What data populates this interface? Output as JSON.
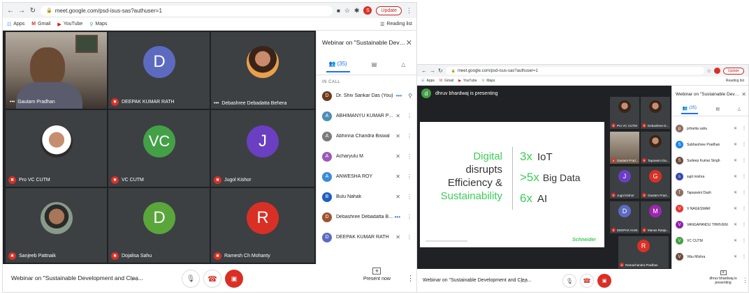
{
  "left": {
    "url": "meet.google.com/psd-isus-sas?authuser=1",
    "update_label": "Update",
    "profile_initial": "S",
    "bookmarks": [
      "Apps",
      "Gmail",
      "YouTube",
      "Maps"
    ],
    "reading_list": "Reading list",
    "tiles": [
      {
        "name": "Gautam Pradhan",
        "kind": "video"
      },
      {
        "name": "DEEPAK KUMAR RATH",
        "initial": "D",
        "color": "#5c6bc0"
      },
      {
        "name": "Debashree Debadatta Behera",
        "kind": "photo"
      },
      {
        "name": "Pro VC CUTM",
        "kind": "photo"
      },
      {
        "name": "VC CUTM",
        "initial": "VC",
        "color": "#43a047"
      },
      {
        "name": "Jugol Kishor",
        "initial": "J",
        "color": "#6a3fc1"
      },
      {
        "name": "Sanjeeb Pattnaik",
        "kind": "photo"
      },
      {
        "name": "Dojalisa Sahu",
        "initial": "D",
        "color": "#5aa63b"
      },
      {
        "name": "Ramesh Ch Mohanty",
        "initial": "R",
        "color": "#d93025"
      }
    ],
    "meeting_title": "Webinar on \"Sustainable Development and Clea...",
    "present_label": "Present now",
    "panel_title": "Webinar on \"Sustainable Develop...",
    "people_count": "(35)",
    "in_call": "IN CALL",
    "participants": [
      {
        "name": "Dr. Shiv Sankar Das (You)",
        "initial": "D",
        "color": "#6d3b1d"
      },
      {
        "name": "ABHIMANYU KUMAR PA...",
        "initial": "A",
        "color": "#4a8fb5",
        "photo": true
      },
      {
        "name": "Abhinna Chandra Biswal",
        "initial": "A",
        "color": "#7a7a7a",
        "photo": true
      },
      {
        "name": "Acharyulu M",
        "initial": "A",
        "color": "#9b59b6"
      },
      {
        "name": "ANWESHA ROY",
        "initial": "A",
        "color": "#3b8ad9"
      },
      {
        "name": "Bulu Nahak",
        "initial": "B",
        "color": "#1f5fbf"
      },
      {
        "name": "Debashree Debadatta B...",
        "initial": "D",
        "color": "#a0522d",
        "photo": true
      },
      {
        "name": "DEEPAK KUMAR RATH",
        "initial": "D",
        "color": "#5c6bc0"
      }
    ]
  },
  "right": {
    "url": "meet.google.com/psd-isus-sas?authuser=1",
    "update_label": "Update",
    "bookmarks": [
      "Apps",
      "Gmail",
      "YouTube",
      "Maps"
    ],
    "reading_list": "Reading list",
    "presenter_initial": "d",
    "presenting_banner": "dhruv bhardwaj is presenting",
    "slide": {
      "left_lines": [
        "Digital",
        "disrupts",
        "Efficiency &",
        "Sustainability"
      ],
      "stats": [
        {
          "num": "3x",
          "label": "IoT"
        },
        {
          "num": ">5x",
          "label": "Big Data"
        },
        {
          "num": "6x",
          "label": "AI"
        }
      ],
      "brand": "Schneider"
    },
    "tiles": [
      {
        "name": "Pro VC CUTM",
        "kind": "photo"
      },
      {
        "name": "Debashree D...",
        "kind": "photo"
      },
      {
        "name": "Gautam Prad...",
        "kind": "video"
      },
      {
        "name": "Tapaswini Da...",
        "kind": "photo"
      },
      {
        "name": "Jugol Kishor",
        "initial": "J",
        "color": "#6a3fc1"
      },
      {
        "name": "Gautam Prad...",
        "initial": "G",
        "color": "#d93025"
      },
      {
        "name": "DEEPAK KUM...",
        "initial": "D",
        "color": "#5c6bc0"
      },
      {
        "name": "Manas Ranja...",
        "initial": "M",
        "color": "#9c27b0"
      },
      {
        "name": "Ramachandra Pradhan",
        "initial": "R",
        "color": "#d93025"
      }
    ],
    "meeting_title": "Webinar on \"Sustainable Development and Clea...",
    "presenting_label": "dhruv bhardwaj is presenting",
    "panel_title": "Webinar on \"Sustainable Develop...",
    "people_count": "(35)",
    "participants": [
      {
        "name": "prharita sahu",
        "initial": "p",
        "color": "#8d6e63",
        "photo": true
      },
      {
        "name": "Subhashree Pradhan",
        "initial": "S",
        "color": "#1e88e5"
      },
      {
        "name": "Sudeep Kumar Singh",
        "initial": "S",
        "color": "#6d4c41",
        "photo": true
      },
      {
        "name": "sujit mishra",
        "initial": "s",
        "color": "#3949ab"
      },
      {
        "name": "Tapaswini Dash",
        "initial": "T",
        "color": "#8d6e63",
        "photo": true
      },
      {
        "name": "V NAGESWAR",
        "initial": "V",
        "color": "#e53935"
      },
      {
        "name": "VANGAPANDU THRIVENI",
        "initial": "V",
        "color": "#8e24aa"
      },
      {
        "name": "VC CUTM",
        "initial": "V",
        "color": "#43a047"
      },
      {
        "name": "Vibu Mishra",
        "initial": "V",
        "color": "#6d4c41",
        "photo": true
      }
    ]
  }
}
